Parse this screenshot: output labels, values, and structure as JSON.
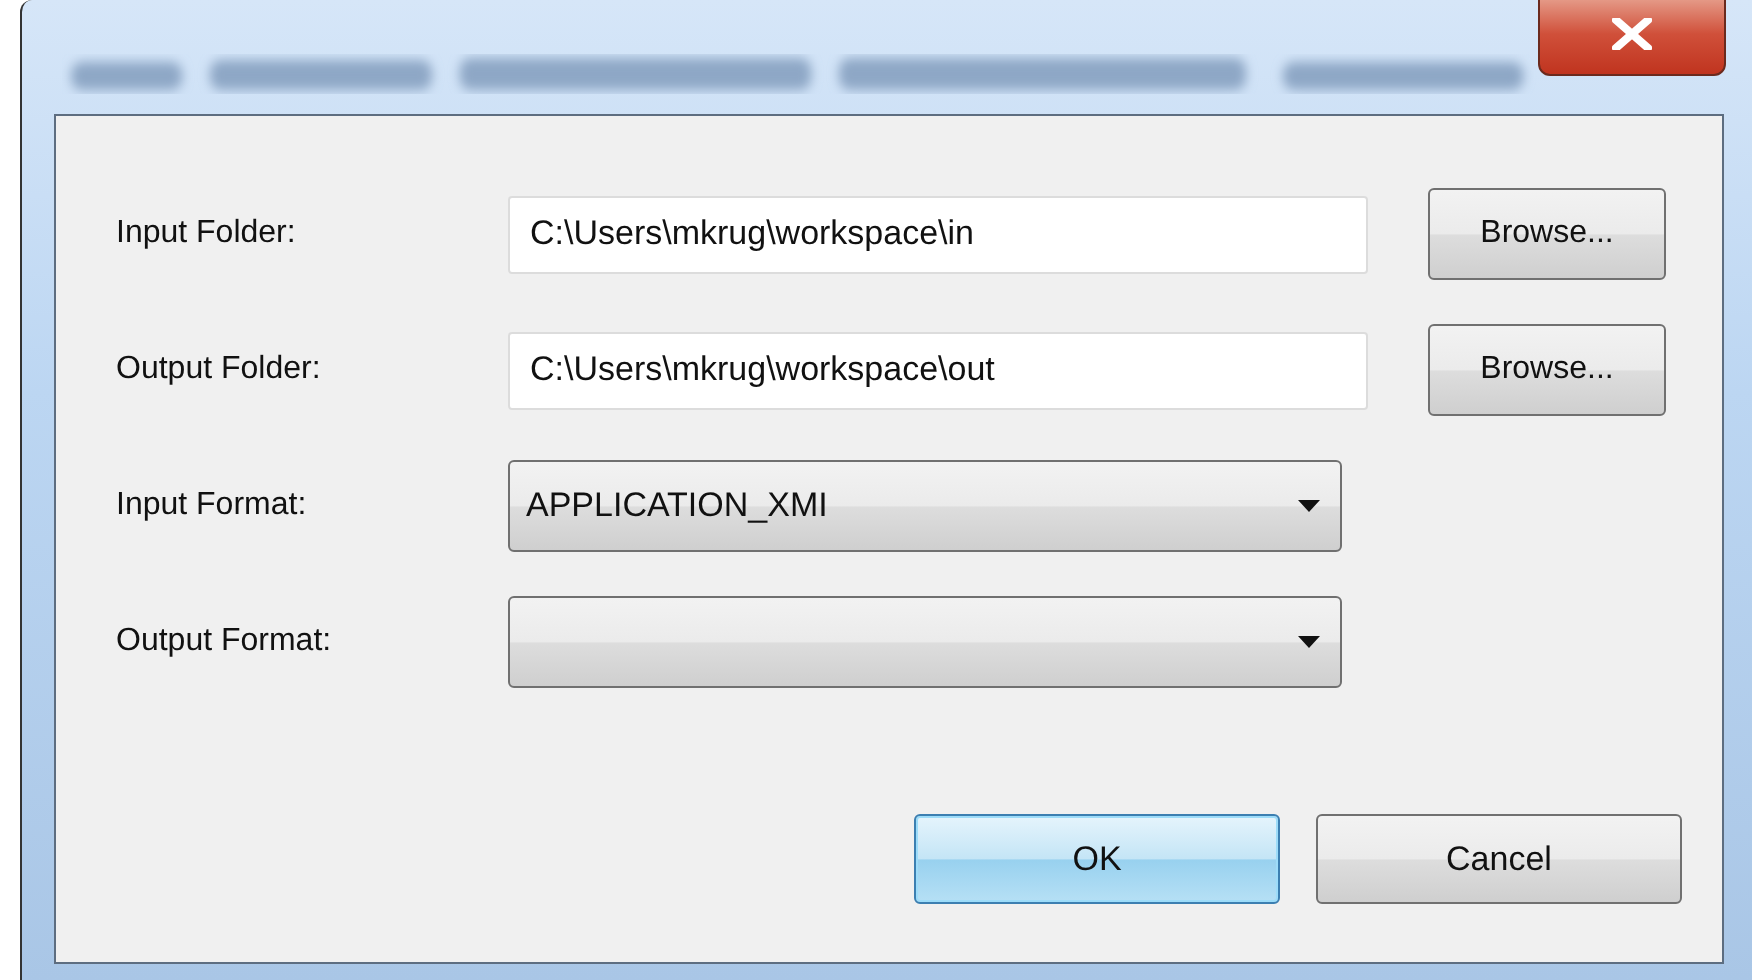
{
  "rows": [
    {
      "kind": "folder",
      "label": "Input Folder:",
      "value": "C:\\Users\\mkrug\\workspace\\in",
      "button": "Browse..."
    },
    {
      "kind": "folder",
      "label": "Output Folder:",
      "value": "C:\\Users\\mkrug\\workspace\\out",
      "button": "Browse..."
    },
    {
      "kind": "dropdown",
      "label": "Input Format:",
      "value": "APPLICATION_XMI"
    },
    {
      "kind": "dropdown",
      "label": "Output Format:"
    }
  ],
  "buttons": [
    {
      "label": "OK",
      "default": true
    },
    {
      "label": "Cancel",
      "default": false
    }
  ]
}
